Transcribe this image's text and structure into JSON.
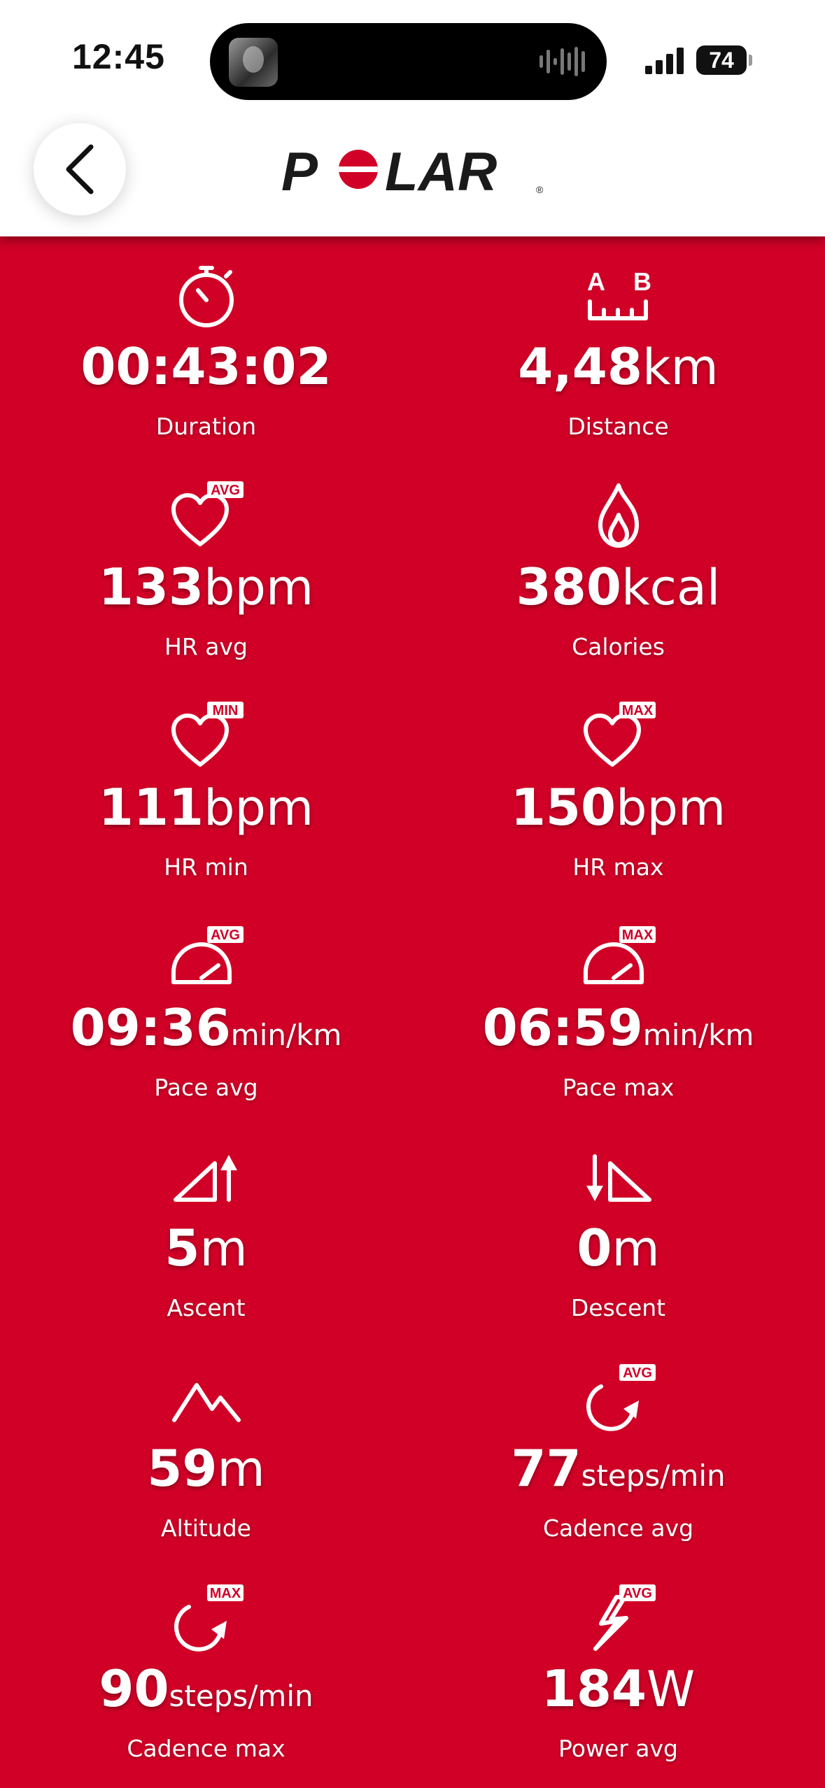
{
  "status_bar": {
    "time": "12:45",
    "battery": "74"
  },
  "header": {
    "brand": "POLAR"
  },
  "metrics": [
    {
      "value": "00:43:02",
      "unit": "",
      "label": "Duration"
    },
    {
      "value": "4,48",
      "unit": "km",
      "label": "Distance"
    },
    {
      "value": "133",
      "unit": "bpm",
      "label": "HR avg"
    },
    {
      "value": "380",
      "unit": "kcal",
      "label": "Calories"
    },
    {
      "value": "111",
      "unit": "bpm",
      "label": "HR min"
    },
    {
      "value": "150",
      "unit": "bpm",
      "label": "HR max"
    },
    {
      "value": "09:36",
      "unit": "min/km",
      "label": "Pace avg"
    },
    {
      "value": "06:59",
      "unit": "min/km",
      "label": "Pace max"
    },
    {
      "value": "5",
      "unit": "m",
      "label": "Ascent"
    },
    {
      "value": "0",
      "unit": "m",
      "label": "Descent"
    },
    {
      "value": "59",
      "unit": "m",
      "label": "Altitude"
    },
    {
      "value": "77",
      "unit": "steps/min",
      "label": "Cadence avg"
    },
    {
      "value": "90",
      "unit": "steps/min",
      "label": "Cadence max"
    },
    {
      "value": "184",
      "unit": "W",
      "label": "Power avg"
    }
  ],
  "icons": [
    "stopwatch-icon",
    "distance-ab-icon",
    "heart-avg-icon",
    "flame-icon",
    "heart-min-icon",
    "heart-max-icon",
    "speedometer-avg-icon",
    "speedometer-max-icon",
    "ascent-icon",
    "descent-icon",
    "mountain-icon",
    "cadence-avg-icon",
    "cadence-max-icon",
    "power-avg-icon"
  ],
  "badges": {
    "avg": "AVG",
    "min": "MIN",
    "max": "MAX",
    "a": "A",
    "b": "B"
  },
  "colors": {
    "background": "#d10027",
    "header": "#ffffff",
    "text": "#ffffff"
  }
}
